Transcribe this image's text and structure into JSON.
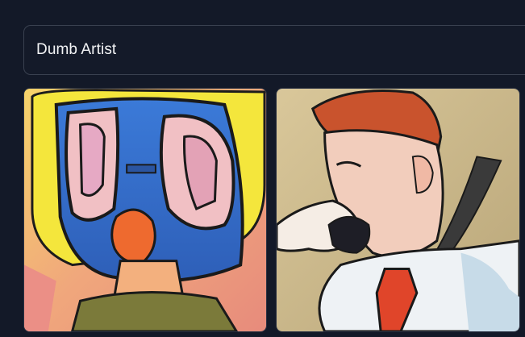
{
  "prompt": {
    "value": "Dumb Artist"
  },
  "gallery": {
    "items": [
      {
        "subject": "abstract-face-painting"
      },
      {
        "subject": "man-with-hand-over-mouth-painting"
      }
    ]
  }
}
